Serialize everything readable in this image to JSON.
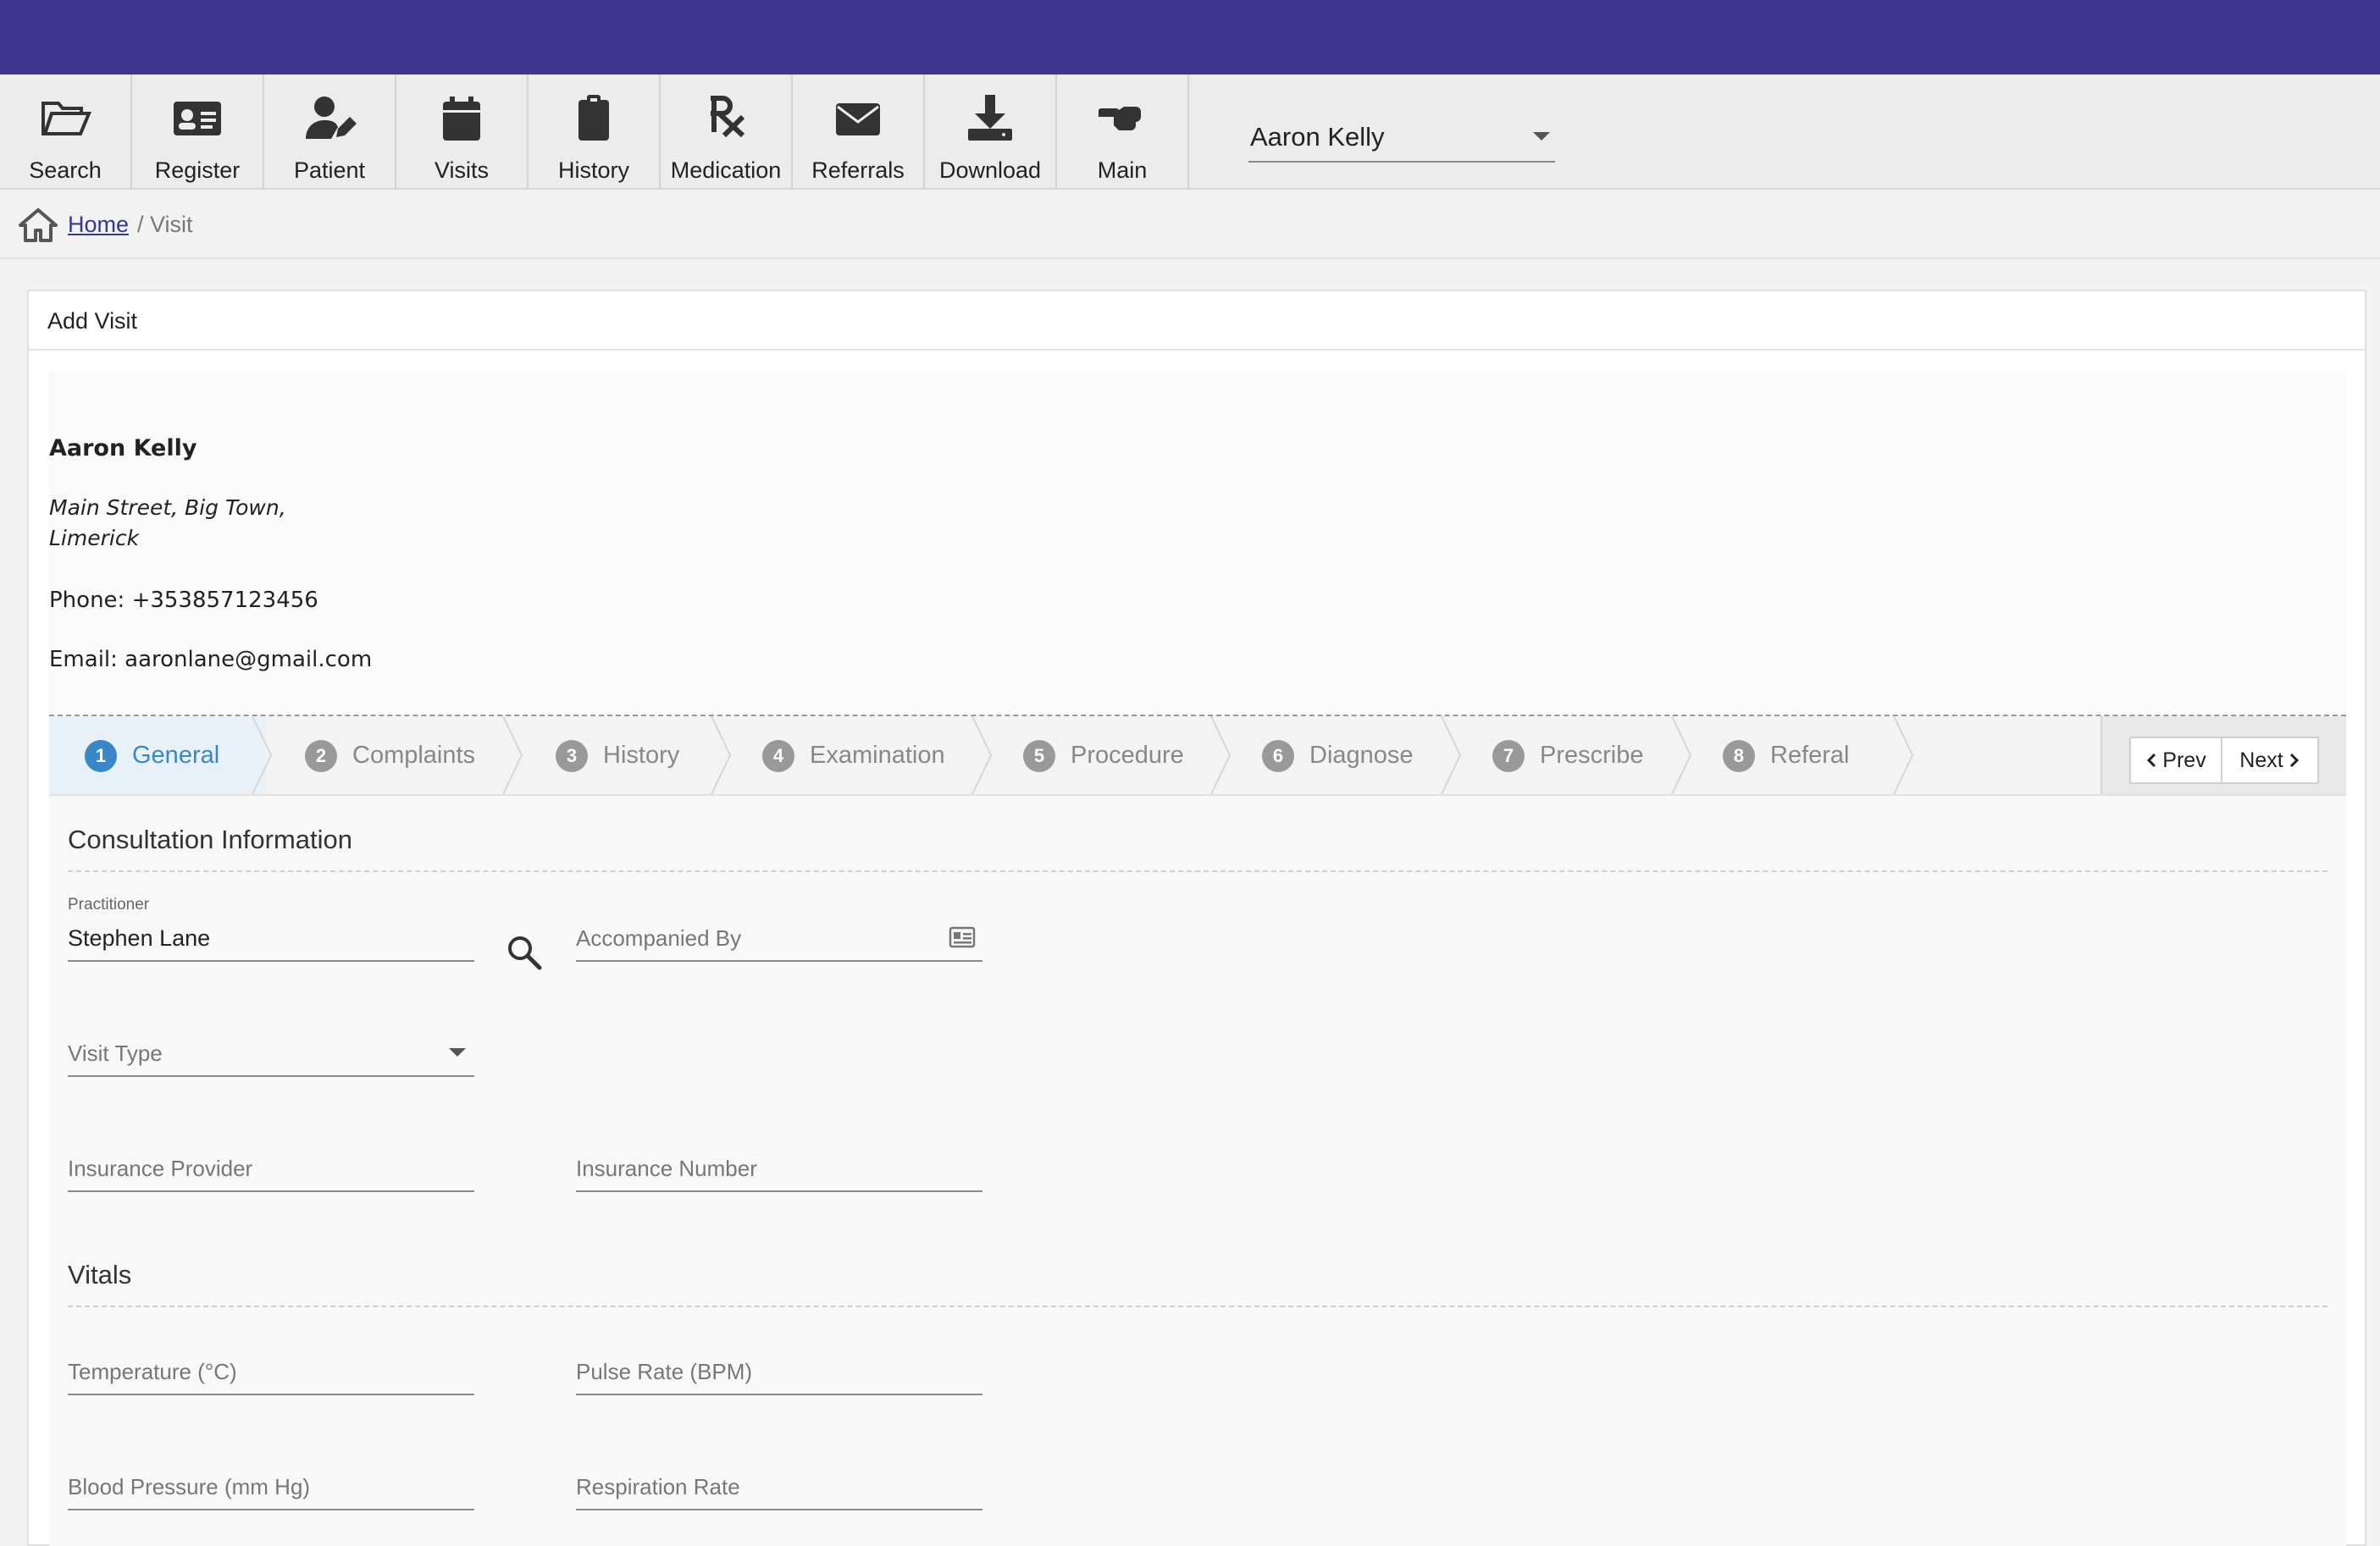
{
  "colors": {
    "topbar": "#3d378f",
    "accent": "#3a87c8",
    "link": "#333a8f"
  },
  "toolbar": {
    "items": [
      {
        "label": "Search",
        "icon": "folder-open-icon"
      },
      {
        "label": "Register",
        "icon": "id-card-icon"
      },
      {
        "label": "Patient",
        "icon": "user-edit-icon"
      },
      {
        "label": "Visits",
        "icon": "calendar-icon"
      },
      {
        "label": "History",
        "icon": "clipboard-icon"
      },
      {
        "label": "Medication",
        "icon": "prescription-icon"
      },
      {
        "label": "Referrals",
        "icon": "envelope-icon"
      },
      {
        "label": "Download",
        "icon": "download-icon"
      },
      {
        "label": "Main",
        "icon": "hand-point-icon"
      }
    ],
    "user_select": "Aaron Kelly"
  },
  "breadcrumb": {
    "home": "Home",
    "current": "/ Visit"
  },
  "panel": {
    "title": "Add Visit"
  },
  "patient": {
    "name": "Aaron Kelly",
    "address_line1": "Main Street, Big Town,",
    "address_line2": "Limerick",
    "phone": "Phone: +353857123456",
    "email": "Email: aaronlane@gmail.com"
  },
  "wizard": {
    "steps": [
      {
        "num": "1",
        "label": "General"
      },
      {
        "num": "2",
        "label": "Complaints"
      },
      {
        "num": "3",
        "label": "History"
      },
      {
        "num": "4",
        "label": "Examination"
      },
      {
        "num": "5",
        "label": "Procedure"
      },
      {
        "num": "6",
        "label": "Diagnose"
      },
      {
        "num": "7",
        "label": "Prescribe"
      },
      {
        "num": "8",
        "label": "Referal"
      }
    ],
    "active_step": 1,
    "prev": "Prev",
    "next": "Next"
  },
  "consultation": {
    "title": "Consultation Information",
    "practitioner_label": "Practitioner",
    "practitioner_value": "Stephen Lane",
    "accompanied_by": "Accompanied By",
    "visit_type": "Visit Type",
    "insurance_provider": "Insurance Provider",
    "insurance_number": "Insurance Number"
  },
  "vitals": {
    "title": "Vitals",
    "temperature": "Temperature (°C)",
    "pulse": "Pulse Rate (BPM)",
    "blood_pressure": "Blood Pressure (mm Hg)",
    "respiration": "Respiration Rate"
  }
}
